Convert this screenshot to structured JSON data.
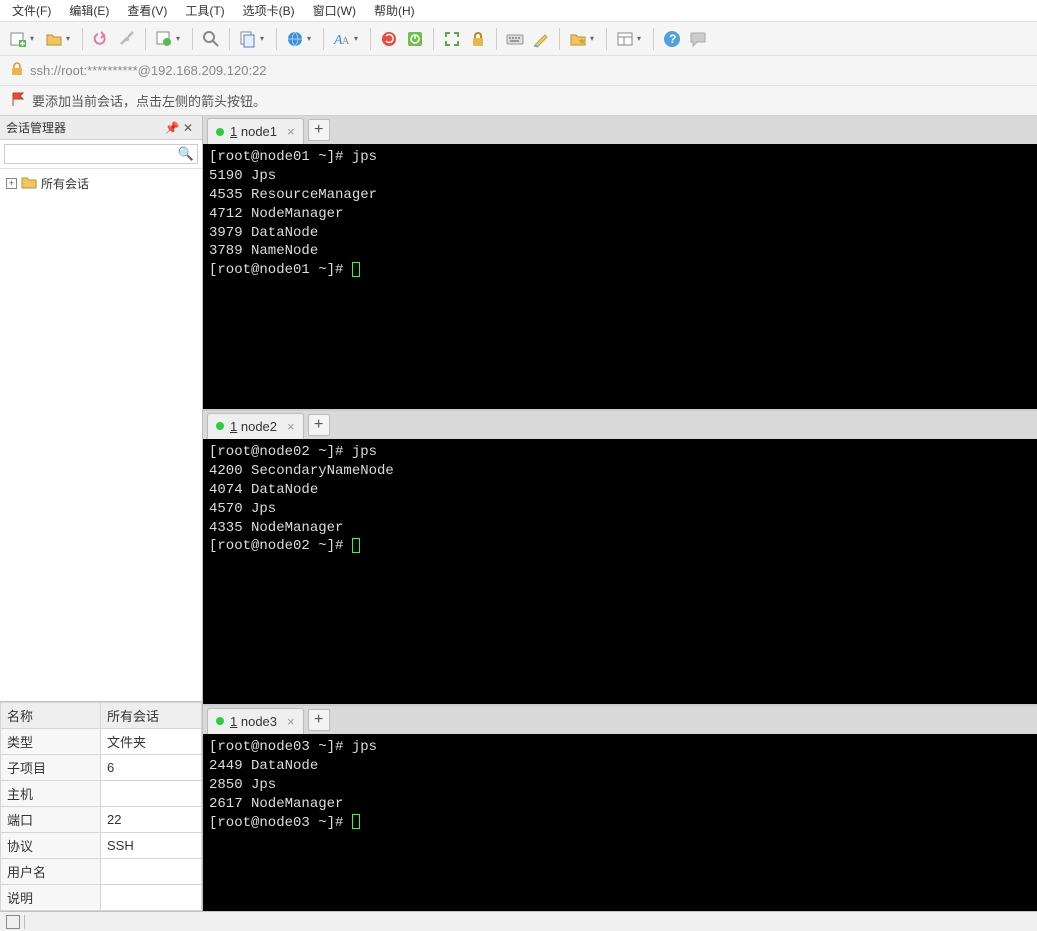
{
  "menu": {
    "file": "文件(F)",
    "edit": "编辑(E)",
    "view": "查看(V)",
    "tools": "工具(T)",
    "tabs": "选项卡(B)",
    "window": "窗口(W)",
    "help": "帮助(H)"
  },
  "address": {
    "text": "ssh://root:**********@192.168.209.120:22"
  },
  "hint": {
    "text": "要添加当前会话，点击左侧的箭头按钮。"
  },
  "sidebar": {
    "title": "会话管理器",
    "search_placeholder": "",
    "tree_root": "所有会话"
  },
  "props": {
    "header_key": "名称",
    "header_val": "所有会话",
    "rows": [
      {
        "k": "类型",
        "v": "文件夹"
      },
      {
        "k": "子项目",
        "v": "6"
      },
      {
        "k": "主机",
        "v": ""
      },
      {
        "k": "端口",
        "v": "22"
      },
      {
        "k": "协议",
        "v": "SSH"
      },
      {
        "k": "用户名",
        "v": ""
      },
      {
        "k": "说明",
        "v": ""
      }
    ]
  },
  "terminals": [
    {
      "tab_prefix": "1",
      "tab_label": "node1",
      "lines": [
        "[root@node01 ~]# jps",
        "5190 Jps",
        "4535 ResourceManager",
        "4712 NodeManager",
        "3979 DataNode",
        "3789 NameNode",
        "[root@node01 ~]# "
      ]
    },
    {
      "tab_prefix": "1",
      "tab_label": "node2",
      "lines": [
        "[root@node02 ~]# jps",
        "4200 SecondaryNameNode",
        "4074 DataNode",
        "4570 Jps",
        "4335 NodeManager",
        "[root@node02 ~]# "
      ]
    },
    {
      "tab_prefix": "1",
      "tab_label": "node3",
      "lines": [
        "[root@node03 ~]# jps",
        "2449 DataNode",
        "2850 Jps",
        "2617 NodeManager",
        "[root@node03 ~]# "
      ]
    }
  ]
}
